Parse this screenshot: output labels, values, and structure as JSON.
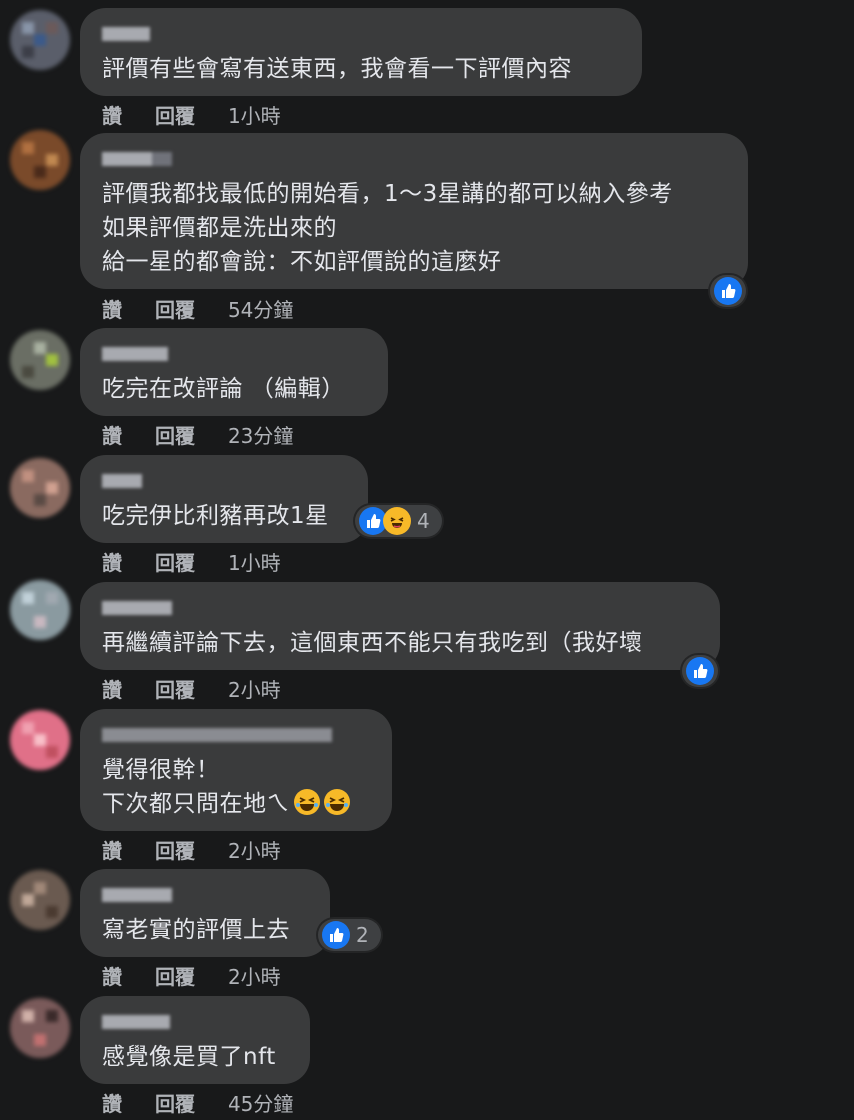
{
  "actions": {
    "like": "讚",
    "reply": "回覆"
  },
  "colors": {
    "background": "#18191a",
    "bubble": "#3a3b3c",
    "like_blue": "#1877f2",
    "haha_yellow": "#f7b928"
  },
  "comments": [
    {
      "text": "評價有些會寫有送東西，我會看一下評價內容",
      "time": "1小時"
    },
    {
      "text": "評價我都找最低的開始看，1～3星講的都可以納入參考\n如果評價都是洗出來的\n給一星的都會說：不如評價說的這麼好",
      "time": "54分鐘",
      "reactions": {
        "icons": [
          "like-icon"
        ]
      }
    },
    {
      "text": "吃完在改評論 （編輯）",
      "time": "23分鐘"
    },
    {
      "text": "吃完伊比利豬再改1星",
      "time": "1小時",
      "reactions": {
        "icons": [
          "like-icon",
          "laughing-icon"
        ],
        "count": "4"
      }
    },
    {
      "text": "再繼續評論下去，這個東西不能只有我吃到（我好壞",
      "time": "2小時",
      "reactions": {
        "icons": [
          "like-icon"
        ]
      }
    },
    {
      "text": "覺得很幹！\n下次都只問在地ㄟ",
      "time": "2小時",
      "emojis": [
        "rofl-icon",
        "rofl-icon"
      ]
    },
    {
      "text": "寫老實的評價上去",
      "time": "2小時",
      "reactions": {
        "icons": [
          "like-icon"
        ],
        "count": "2"
      }
    },
    {
      "text": "感覺像是買了nft",
      "time": "45分鐘"
    }
  ]
}
